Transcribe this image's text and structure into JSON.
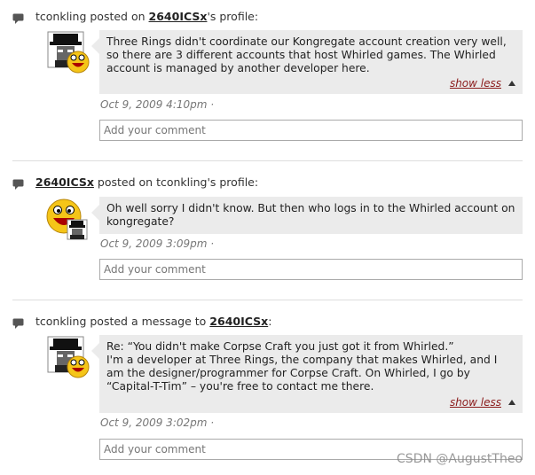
{
  "activities": [
    {
      "author": "tconkling",
      "verb": "posted on",
      "target": "2640ICSx",
      "suffix": "'s profile:",
      "message": "Three Rings didn't coordinate our Kongregate account creation very well, so there are 3 different accounts that host Whirled games. The Whirled account is managed by another developer here.",
      "show_less": "show less",
      "timestamp": "Oct 9, 2009 4:10pm ·",
      "comment_placeholder": "Add your comment",
      "avatar": "spy-hat-avatar-with-smiley"
    },
    {
      "author": "2640ICSx",
      "verb": "posted on",
      "target": "tconkling",
      "suffix": "'s profile:",
      "message": "Oh well sorry I didn't know. But then who logs in to the Whirled account on kongregate?",
      "timestamp": "Oct 9, 2009 3:09pm ·",
      "comment_placeholder": "Add your comment",
      "avatar": "smiley-avatar-with-spy"
    },
    {
      "author": "tconkling",
      "verb": "posted a message to",
      "target": "2640ICSx",
      "suffix": ":",
      "message_line1": "Re: “You didn't make Corpse Craft you just got it from Whirled.”",
      "message": "I'm a developer at Three Rings, the company that makes Whirled, and I am the designer/programmer for Corpse Craft. On Whirled, I go by “Capital-T-Tim” – you're free to contact me there.",
      "show_less": "show less",
      "timestamp": "Oct 9, 2009 3:02pm ·",
      "comment_placeholder": "Add your comment",
      "avatar": "spy-hat-avatar-with-smiley"
    }
  ],
  "watermark": "CSDN @AugustTheo",
  "colors": {
    "message_bg": "#ebebeb",
    "show_less": "#8a1a1a",
    "timestamp": "#777777"
  }
}
